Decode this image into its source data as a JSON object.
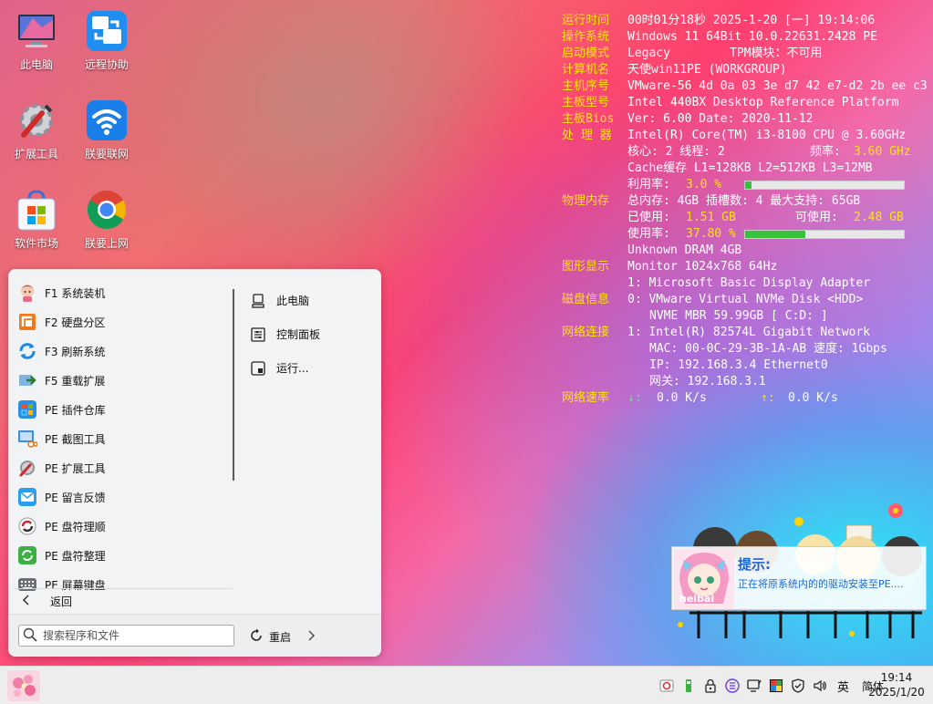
{
  "desktop": {
    "icons": [
      {
        "label": "此电脑",
        "icon": "monitor-icon"
      },
      {
        "label": "远程协助",
        "icon": "remote-assist-icon"
      },
      {
        "label": "扩展工具",
        "icon": "tools-icon"
      },
      {
        "label": "朕要联网",
        "icon": "wifi-icon"
      },
      {
        "label": "软件市场",
        "icon": "store-icon"
      },
      {
        "label": "朕要上网",
        "icon": "chrome-icon"
      }
    ]
  },
  "sysinfo": {
    "uptime": {
      "key": "运行时间",
      "value": "00时01分18秒 2025-1-20 [一] 19:14:06"
    },
    "os": {
      "key": "操作系统",
      "value": "Windows 11 64Bit 10.0.22631.2428 PE"
    },
    "boot": {
      "key": "启动模式",
      "value": "Legacy",
      "tpm": "TPM模块：不可用"
    },
    "computer": {
      "key": "计算机名",
      "value": "天使win11PE (WORKGROUP)"
    },
    "serial": {
      "key": "主机序号",
      "value": "VMware-56 4d 0a 03 3e d7 42 e7-d2 2b ee c3"
    },
    "board": {
      "key": "主板型号",
      "value": "Intel 440BX Desktop Reference Platform"
    },
    "bios": {
      "key": "主板Bios",
      "value": "Ver: 6.00 Date: 2020-11-12"
    },
    "cpu": {
      "key": "处 理 器",
      "model": "Intel(R) Core(TM) i3-8100 CPU @ 3.60GHz",
      "cores": "核心: 2  线程: 2",
      "freq_label": "频率:",
      "freq": "3.60 GHz",
      "cache": "Cache缓存 L1=128KB  L2=512KB  L3=12MB",
      "usage_label": "利用率:",
      "usage": "3.0 %",
      "usage_fraction": 0.03
    },
    "memory": {
      "key": "物理内存",
      "line1": "总内存: 4GB  插槽数: 4  最大支持: 65GB",
      "used_label": "已使用:",
      "used": "1.51 GB",
      "avail_label": "可使用:",
      "avail": "2.48 GB",
      "usage_label": "使用率:",
      "usage": "37.80 %",
      "usage_fraction": 0.378,
      "dram": "Unknown  DRAM 4GB"
    },
    "gpu": {
      "key": "图形显示",
      "line1": "Monitor 1024x768 64Hz",
      "line2": "1: Microsoft Basic Display Adapter"
    },
    "disk": {
      "key": "磁盘信息",
      "line1": "0: VMware Virtual NVMe Disk <HDD>",
      "line2": "NVME MBR 59.99GB [ C:D: ]"
    },
    "net": {
      "key": "网络连接",
      "line1": "1: Intel(R) 82574L Gigabit Network",
      "line2": "MAC: 00-0C-29-3B-1A-AB 速度: 1Gbps",
      "line3": "IP:  192.168.3.4 Ethernet0",
      "line4": "网关: 192.168.3.1"
    },
    "speed": {
      "key": "网络速率",
      "down_arrow": "↓:",
      "down": "0.0 K/s",
      "up_arrow": "↑:",
      "up": "0.0 K/s"
    }
  },
  "startmenu": {
    "items": [
      {
        "label": "F1 系统装机",
        "icon": "anime-avatar-icon"
      },
      {
        "label": "F2 硬盘分区",
        "icon": "partition-icon"
      },
      {
        "label": "F3 刷新系统",
        "icon": "refresh-icon"
      },
      {
        "label": "F5 重载扩展",
        "icon": "reload-extension-icon"
      },
      {
        "label": "PE 插件仓库",
        "icon": "plugin-store-icon"
      },
      {
        "label": "PE 截图工具",
        "icon": "screenshot-icon"
      },
      {
        "label": "PE 扩展工具",
        "icon": "extension-tools-icon"
      },
      {
        "label": "PE 留言反馈",
        "icon": "mail-icon"
      },
      {
        "label": "PE 盘符理顺",
        "icon": "drive-order-icon"
      },
      {
        "label": "PE 盘符整理",
        "icon": "drive-organize-icon"
      },
      {
        "label": "PE 屏幕键盘",
        "icon": "keyboard-icon"
      }
    ],
    "right": [
      {
        "label": "此电脑",
        "icon": "computer-icon"
      },
      {
        "label": "控制面板",
        "icon": "control-panel-icon"
      },
      {
        "label": "运行...",
        "icon": "run-icon"
      }
    ],
    "back": "返回",
    "search_placeholder": "搜索程序和文件",
    "restart": "重启"
  },
  "toast": {
    "title": "提示:",
    "message": "正在将原系统内的的驱动安装至PE....",
    "logo_text": "heibai"
  },
  "taskbar": {
    "lang": "英",
    "ime": "简体",
    "time": "19:14",
    "date": "2025/1/20"
  },
  "colors": {
    "accent_key": "#ffe312",
    "value": "#ffffff",
    "bar_fill": "#36c23a",
    "toast_text": "#1a66d6"
  }
}
